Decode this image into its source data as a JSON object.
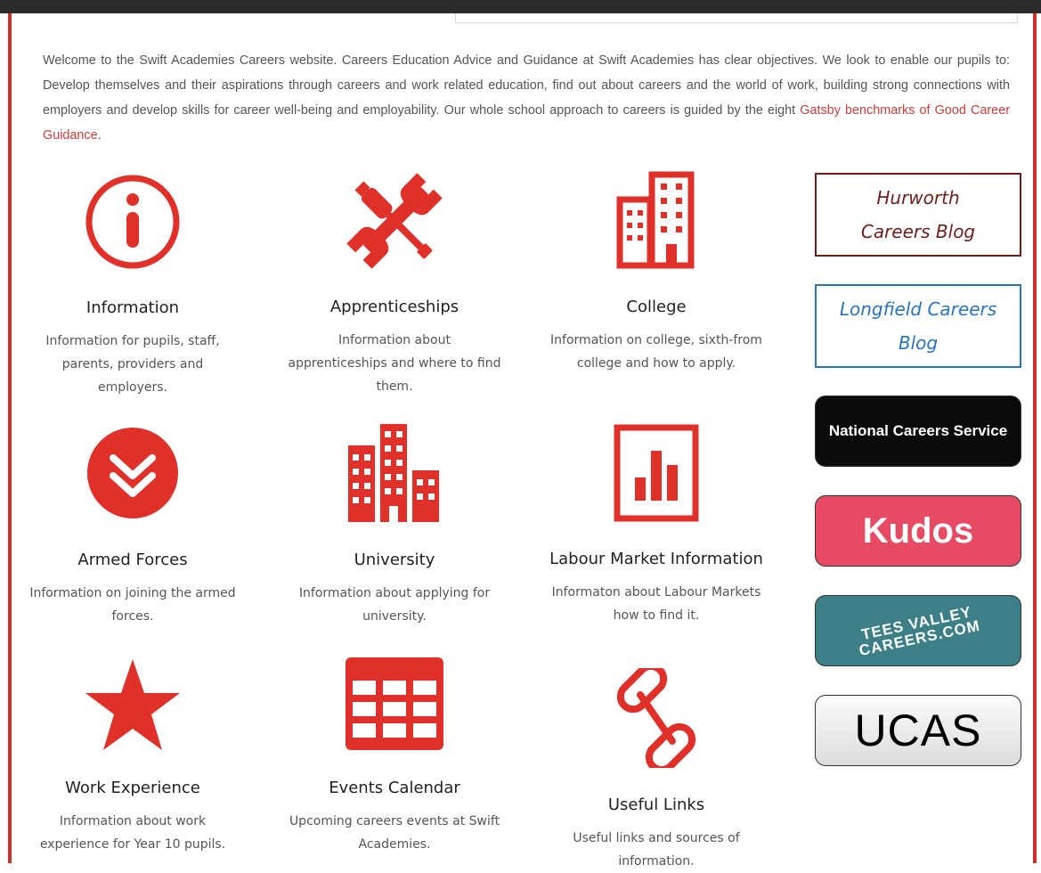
{
  "intro": {
    "text": "Welcome to the Swift Academies Careers website. Careers Education Advice and Guidance at Swift Academies has clear objectives. We look to enable our pupils to: Develop themselves and their aspirations through careers and work related education, find out about careers and the world of work, building strong connections with employers and develop skills for career well-being and employability. Our whole school approach to careers is guided by the eight ",
    "link": "Gatsby benchmarks of Good Career Guidance",
    "end": "."
  },
  "items": [
    {
      "title": "Information",
      "desc": "Information for pupils, staff, parents, providers and employers.",
      "icon": "info-icon"
    },
    {
      "title": "Apprenticeships",
      "desc": "Information about apprenticeships and where to find them.",
      "icon": "tools-icon"
    },
    {
      "title": "College",
      "desc": "Information on college, sixth-from college and how to apply.",
      "icon": "building-icon"
    },
    {
      "title": "Armed Forces",
      "desc": "Information on joining the armed forces.",
      "icon": "chevrons-down-icon"
    },
    {
      "title": "University",
      "desc": "Information about applying for university.",
      "icon": "city-icon"
    },
    {
      "title": "Labour Market Information",
      "desc": "Informaton about Labour Markets how to find it.",
      "icon": "bar-chart-icon"
    },
    {
      "title": "Work Experience",
      "desc": "Information about work experience for Year 10 pupils.",
      "icon": "star-icon"
    },
    {
      "title": "Events Calendar",
      "desc": "Upcoming careers events at Swift Academies.",
      "icon": "table-icon"
    },
    {
      "title": "Useful Links",
      "desc": "Useful links and sources of information.",
      "icon": "paperclip-icon"
    }
  ],
  "sidebar": {
    "hurworth": "Hurworth Careers Blog",
    "longfield": "Longfield Careers Blog",
    "ncs": "National Careers Service",
    "kudos": "Kudos",
    "tees": "TEES VALLEY CAREERS.COM",
    "ucas": "UCAS"
  },
  "colors": {
    "accent": "#e0302a",
    "frame": "#d2302b",
    "link": "#c8403c"
  }
}
